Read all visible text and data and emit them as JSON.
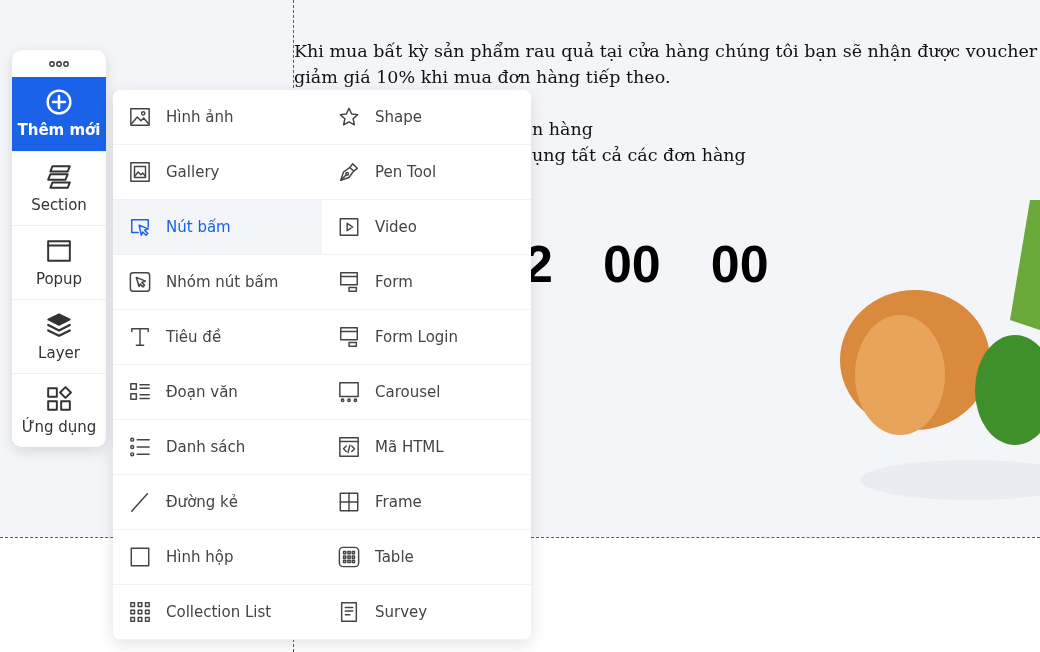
{
  "canvas": {
    "paragraph": "Khi mua bất kỳ sản phẩm rau quả tại cửa hàng chúng tôi bạn sẽ nhận được voucher giảm giá 10% khi mua đơn hàng tiếp theo.",
    "list_fragments": [
      "n hàng",
      "ụng tất cả các đơn hàng"
    ],
    "countdown": [
      "2",
      "00",
      "00"
    ]
  },
  "sidebar": {
    "items": [
      {
        "label": "Thêm mới",
        "selected": true
      },
      {
        "label": "Section",
        "selected": false
      },
      {
        "label": "Popup",
        "selected": false
      },
      {
        "label": "Layer",
        "selected": false
      },
      {
        "label": "Ứng dụng",
        "selected": false
      }
    ]
  },
  "menu": {
    "items": [
      {
        "label": "Hình ảnh",
        "selected": false
      },
      {
        "label": "Shape",
        "selected": false
      },
      {
        "label": "Gallery",
        "selected": false
      },
      {
        "label": "Pen Tool",
        "selected": false
      },
      {
        "label": "Nút bấm",
        "selected": true
      },
      {
        "label": "Video",
        "selected": false
      },
      {
        "label": "Nhóm nút bấm",
        "selected": false
      },
      {
        "label": "Form",
        "selected": false
      },
      {
        "label": "Tiêu đề",
        "selected": false
      },
      {
        "label": "Form Login",
        "selected": false
      },
      {
        "label": "Đoạn văn",
        "selected": false
      },
      {
        "label": "Carousel",
        "selected": false
      },
      {
        "label": "Danh sách",
        "selected": false
      },
      {
        "label": "Mã HTML",
        "selected": false
      },
      {
        "label": "Đường kẻ",
        "selected": false
      },
      {
        "label": "Frame",
        "selected": false
      },
      {
        "label": "Hình hộp",
        "selected": false
      },
      {
        "label": "Table",
        "selected": false
      },
      {
        "label": "Collection List",
        "selected": false
      },
      {
        "label": "Survey",
        "selected": false
      }
    ]
  }
}
